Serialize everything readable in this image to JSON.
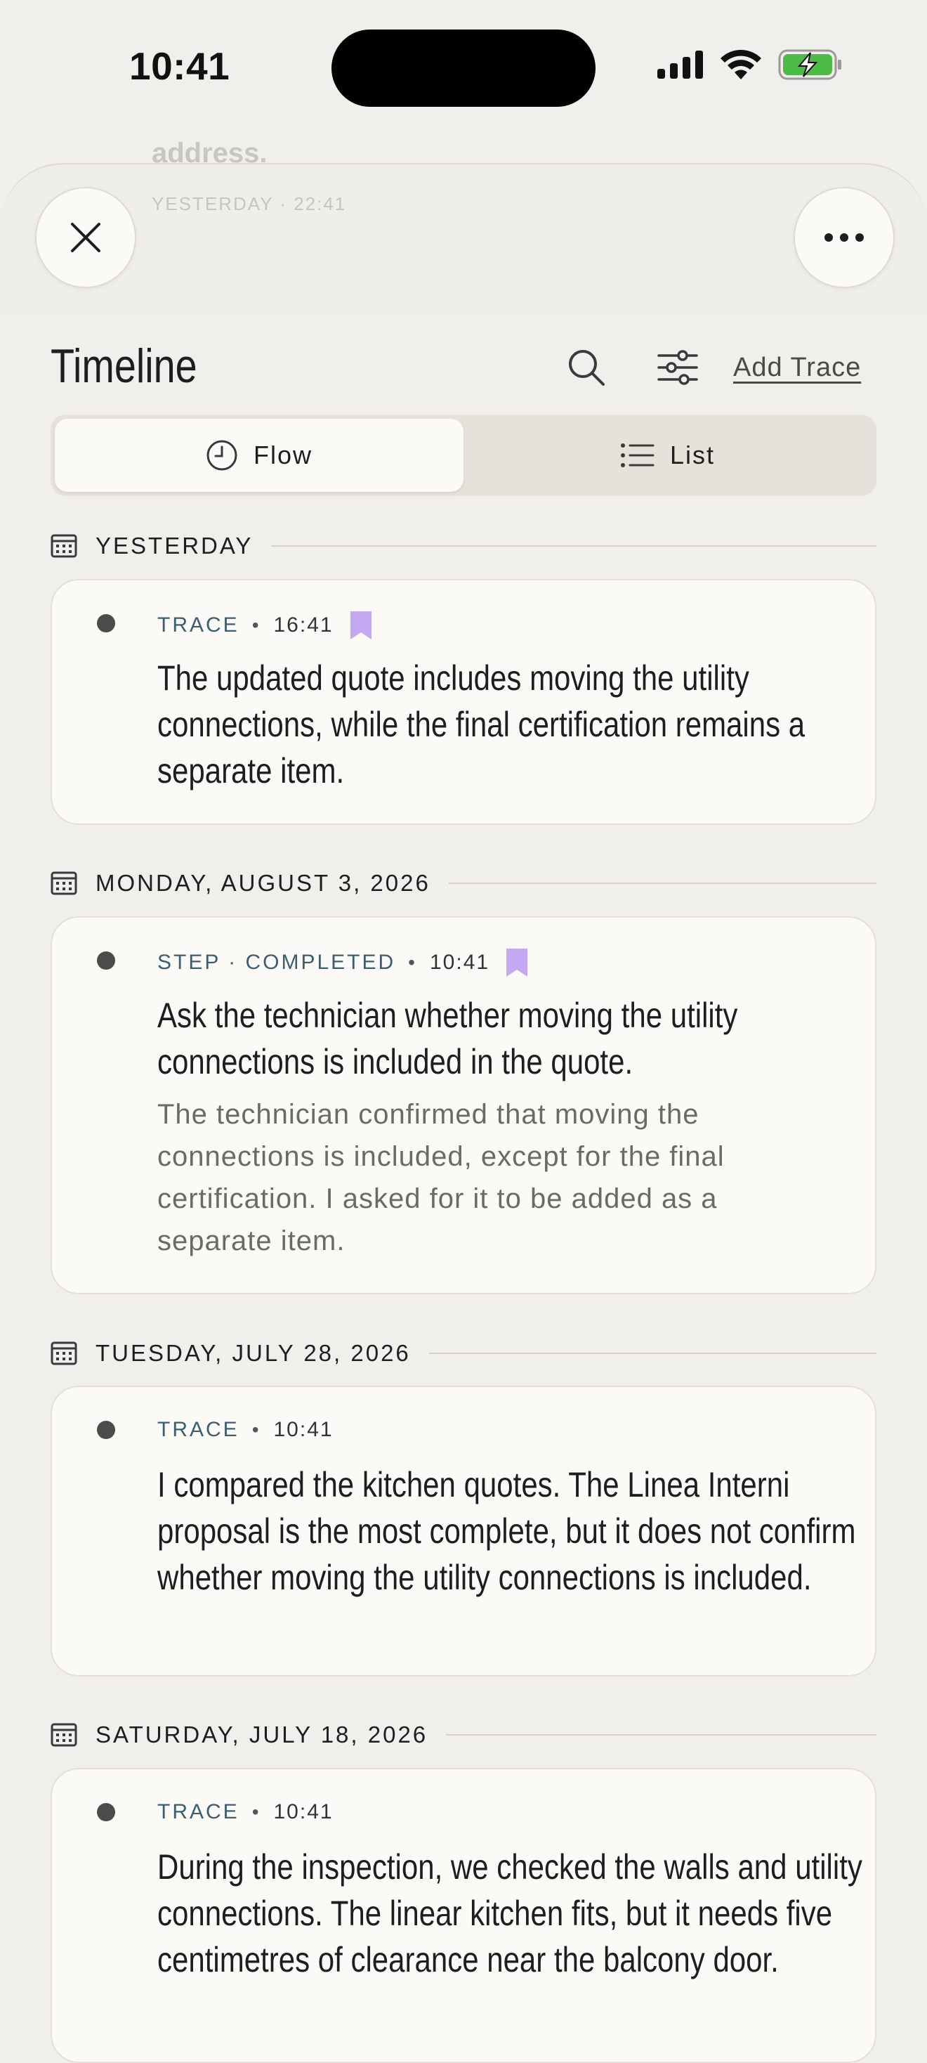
{
  "status_bar": {
    "time": "10:41"
  },
  "ghost_header": {
    "text": "address.",
    "meta": "YESTERDAY · 22:41"
  },
  "header": {
    "title": "Timeline",
    "add_trace_label": "Add Trace"
  },
  "segmented": {
    "flow_label": "Flow",
    "list_label": "List",
    "selected": "Flow"
  },
  "groups": [
    {
      "date": "YESTERDAY",
      "entry": {
        "kind": "TRACE",
        "time": "16:41",
        "bookmarked": true,
        "text": "The updated quote includes moving the utility connections, while the final certification remains a separate item."
      }
    },
    {
      "date": "MONDAY, AUGUST 3, 2026",
      "entry": {
        "kind": "STEP · COMPLETED",
        "time": "10:41",
        "bookmarked": true,
        "text": "Ask the technician whether moving the utility connections is included in the quote.",
        "note": "The technician confirmed that moving the connections is included, except for the final certification. I asked for it to be added as a separate item."
      }
    },
    {
      "date": "TUESDAY, JULY 28, 2026",
      "entry": {
        "kind": "TRACE",
        "time": "10:41",
        "bookmarked": false,
        "text": "I compared the kitchen quotes. The Linea Interni proposal is the most complete, but it does not confirm whether moving the utility connections is included."
      }
    },
    {
      "date": "SATURDAY, JULY 18, 2026",
      "entry": {
        "kind": "TRACE",
        "time": "10:41",
        "bookmarked": false,
        "text": "During the inspection, we checked the walls and utility connections. The linear kitchen fits, but it needs five centimetres of clearance near the balcony door."
      }
    }
  ],
  "colors": {
    "accent": "#3c5e70",
    "bookmark": "#c4a8f2",
    "background": "#f1efeb",
    "card": "#fbfaf7"
  }
}
